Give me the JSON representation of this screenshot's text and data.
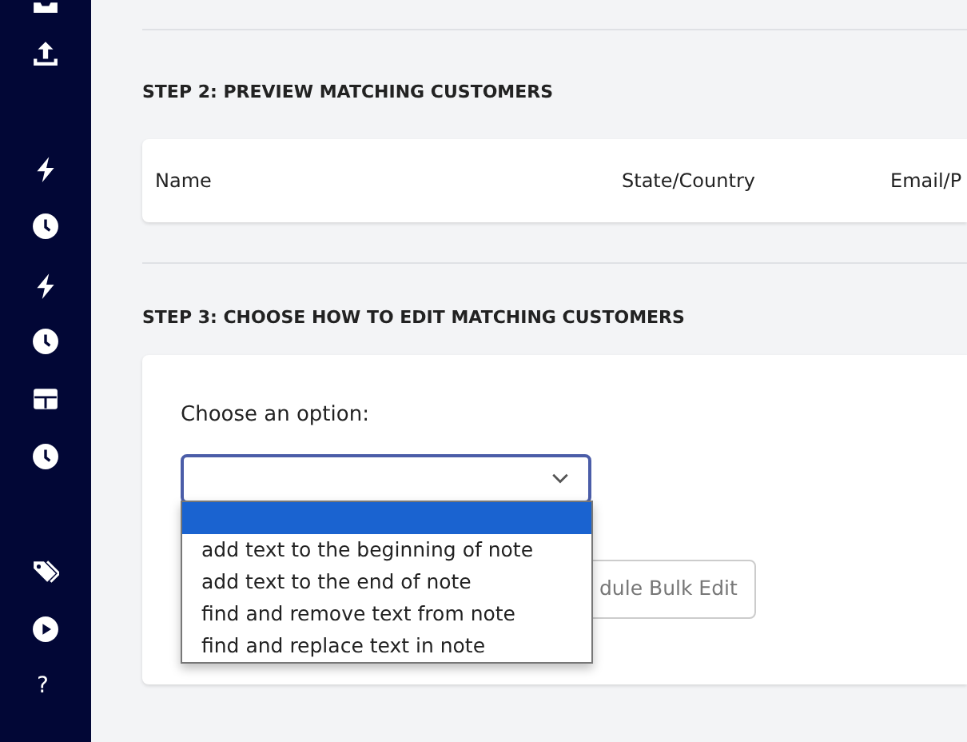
{
  "sidebar": {
    "help_label": "?"
  },
  "step2": {
    "title": "STEP 2: PREVIEW MATCHING CUSTOMERS",
    "columns": [
      "Name",
      "State/Country",
      "Email/P"
    ]
  },
  "step3": {
    "title": "STEP 3: CHOOSE HOW TO EDIT MATCHING CUSTOMERS",
    "label": "Choose an option:",
    "dropdown": {
      "expanded": true,
      "options": [
        {
          "selected": true
        },
        {
          "label": "add text to the beginning of note",
          "selected": false
        },
        {
          "label": "add text to the end of note",
          "selected": false
        },
        {
          "label": "find and remove text from note",
          "selected": false
        },
        {
          "label": "find and replace text in note",
          "selected": false
        }
      ]
    },
    "button": "dule Bulk Edit"
  }
}
